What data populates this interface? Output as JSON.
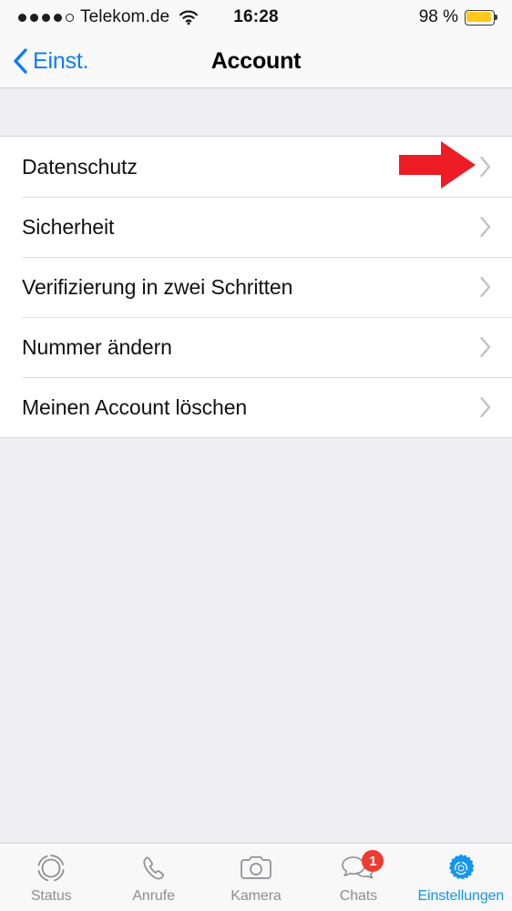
{
  "status_bar": {
    "signal_dots_filled": 4,
    "signal_dots_total": 5,
    "carrier": "Telekom.de",
    "wifi_icon": "wifi-icon",
    "time": "16:28",
    "battery_percent": "98 %",
    "battery_color": "#FFC91E"
  },
  "nav_bar": {
    "back_label": "Einst.",
    "back_icon": "chevron-left-icon",
    "title": "Account",
    "accent_color": "#0A7CFF"
  },
  "list": {
    "rows": [
      {
        "label": "Datenschutz",
        "chevron": "chevron-right-icon"
      },
      {
        "label": "Sicherheit",
        "chevron": "chevron-right-icon"
      },
      {
        "label": "Verifizierung in zwei Schritten",
        "chevron": "chevron-right-icon"
      },
      {
        "label": "Nummer ändern",
        "chevron": "chevron-right-icon"
      },
      {
        "label": "Meinen Account löschen",
        "chevron": "chevron-right-icon"
      }
    ]
  },
  "annotation": {
    "arrow_icon": "red-arrow-right-icon",
    "color": "#EE1C25",
    "points_at": "Datenschutz"
  },
  "tab_bar": {
    "tabs": [
      {
        "label": "Status",
        "icon": "status-rings-icon",
        "active": false,
        "badge": ""
      },
      {
        "label": "Anrufe",
        "icon": "phone-icon",
        "active": false,
        "badge": ""
      },
      {
        "label": "Kamera",
        "icon": "camera-icon",
        "active": false,
        "badge": ""
      },
      {
        "label": "Chats",
        "icon": "chat-bubbles-icon",
        "active": false,
        "badge": "1"
      },
      {
        "label": "Einstellungen",
        "icon": "gear-icon",
        "active": true,
        "badge": ""
      }
    ],
    "active_color": "#1296F0",
    "inactive_color": "#8E8E93",
    "badge_color": "#F03A2F"
  }
}
